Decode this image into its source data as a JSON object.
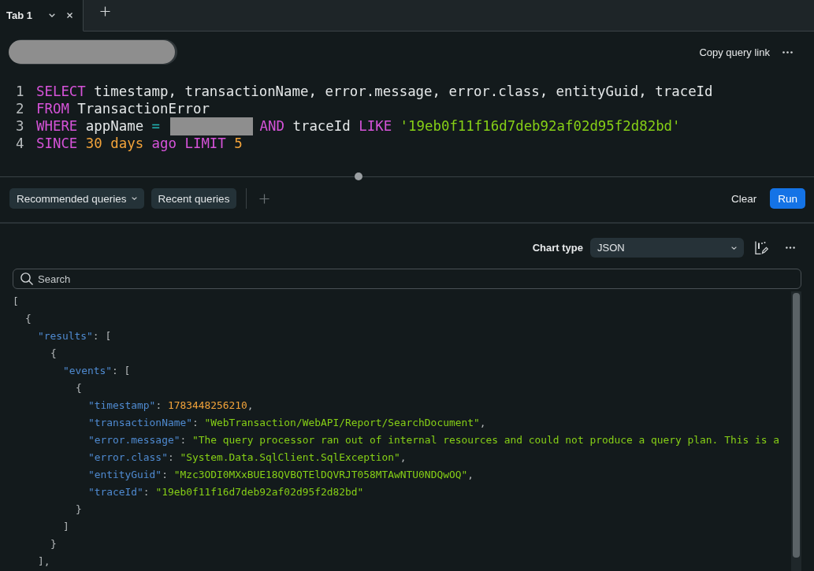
{
  "tabs": [
    {
      "label": "Tab 1",
      "selected": true
    }
  ],
  "query_header": {
    "name": {
      "kind": "redacted"
    },
    "copy_link": "Copy query link"
  },
  "editor": {
    "lines": [
      {
        "number": "1",
        "segments": [
          {
            "kind": "code",
            "tokens": [
              {
                "kind": "keyword",
                "text": "SELECT"
              },
              {
                "kind": "ident",
                "text": " timestamp, transactionName, error.message, error.class, entityGuid, traceId"
              }
            ]
          }
        ]
      },
      {
        "number": "2",
        "segments": [
          {
            "kind": "code",
            "tokens": [
              {
                "kind": "keyword",
                "text": "FROM"
              },
              {
                "kind": "ident",
                "text": " TransactionError"
              }
            ]
          }
        ]
      },
      {
        "number": "3",
        "segments": [
          {
            "kind": "code",
            "tokens": [
              {
                "kind": "keyword",
                "text": "WHERE"
              },
              {
                "kind": "ident",
                "text": " appName "
              },
              {
                "kind": "operator",
                "text": "="
              }
            ]
          },
          {
            "kind": "redacted"
          },
          {
            "kind": "code",
            "tokens": [
              {
                "kind": "keyword",
                "text": "AND"
              },
              {
                "kind": "ident",
                "text": " traceId "
              },
              {
                "kind": "keyword",
                "text": "LIKE"
              },
              {
                "kind": "string",
                "text": " '19eb0f11f16d7deb92af02d95f2d82bd'"
              }
            ]
          }
        ]
      },
      {
        "number": "4",
        "segments": [
          {
            "kind": "code",
            "tokens": [
              {
                "kind": "keyword",
                "text": "SINCE"
              },
              {
                "kind": "literal",
                "text": " 30 days"
              },
              {
                "kind": "keyword",
                "text": " ago LIMIT"
              },
              {
                "kind": "literal",
                "text": " 5"
              }
            ]
          }
        ]
      }
    ]
  },
  "query_toolbar": {
    "buttons": [
      {
        "label": "Recommended queries",
        "kind": "dropdown"
      },
      {
        "label": "Recent queries",
        "kind": "plain"
      }
    ],
    "clear": "Clear",
    "run": "Run"
  },
  "results": {
    "chart_type": {
      "label": "Chart type",
      "value": "JSON"
    },
    "search": {
      "placeholder": "Search"
    },
    "json_lines": [
      {
        "tokens": [
          {
            "kind": "punct",
            "text": "["
          }
        ],
        "children": [
          {
            "tokens": [
              {
                "kind": "punct",
                "text": "{"
              }
            ],
            "children": [
              {
                "tokens": [
                  {
                    "kind": "key",
                    "text": "\"results\""
                  },
                  {
                    "kind": "punct",
                    "text": ": ["
                  }
                ],
                "children": [
                  {
                    "tokens": [
                      {
                        "kind": "punct",
                        "text": "{"
                      }
                    ],
                    "children": [
                      {
                        "tokens": [
                          {
                            "kind": "key",
                            "text": "\"events\""
                          },
                          {
                            "kind": "punct",
                            "text": ": ["
                          }
                        ],
                        "children": [
                          {
                            "tokens": [
                              {
                                "kind": "punct",
                                "text": "{"
                              }
                            ],
                            "children": [
                              {
                                "tokens": [
                                  {
                                    "kind": "key",
                                    "text": "\"timestamp\""
                                  },
                                  {
                                    "kind": "punct",
                                    "text": ": "
                                  },
                                  {
                                    "kind": "number",
                                    "text": "1783448256210"
                                  },
                                  {
                                    "kind": "punct",
                                    "text": ","
                                  }
                                ]
                              },
                              {
                                "tokens": [
                                  {
                                    "kind": "key",
                                    "text": "\"transactionName\""
                                  },
                                  {
                                    "kind": "punct",
                                    "text": ": "
                                  },
                                  {
                                    "kind": "string",
                                    "text": "\"WebTransaction/WebAPI/Report/SearchDocument\""
                                  },
                                  {
                                    "kind": "punct",
                                    "text": ","
                                  }
                                ]
                              },
                              {
                                "tokens": [
                                  {
                                    "kind": "key",
                                    "text": "\"error.message\""
                                  },
                                  {
                                    "kind": "punct",
                                    "text": ": "
                                  },
                                  {
                                    "kind": "string",
                                    "text": "\"The query processor ran out of internal resources and could not produce a query plan. This is a"
                                  }
                                ]
                              },
                              {
                                "tokens": [
                                  {
                                    "kind": "key",
                                    "text": "\"error.class\""
                                  },
                                  {
                                    "kind": "punct",
                                    "text": ": "
                                  },
                                  {
                                    "kind": "string",
                                    "text": "\"System.Data.SqlClient.SqlException\""
                                  },
                                  {
                                    "kind": "punct",
                                    "text": ","
                                  }
                                ]
                              },
                              {
                                "tokens": [
                                  {
                                    "kind": "key",
                                    "text": "\"entityGuid\""
                                  },
                                  {
                                    "kind": "punct",
                                    "text": ": "
                                  },
                                  {
                                    "kind": "string",
                                    "text": "\"Mzc3ODI0MXxBUE18QVBQTElDQVRJT058MTAwNTU0NDQwOQ\""
                                  },
                                  {
                                    "kind": "punct",
                                    "text": ","
                                  }
                                ]
                              },
                              {
                                "tokens": [
                                  {
                                    "kind": "key",
                                    "text": "\"traceId\""
                                  },
                                  {
                                    "kind": "punct",
                                    "text": ": "
                                  },
                                  {
                                    "kind": "string",
                                    "text": "\"19eb0f11f16d7deb92af02d95f2d82bd\""
                                  }
                                ]
                              }
                            ]
                          },
                          {
                            "tokens": [
                              {
                                "kind": "punct",
                                "text": "}"
                              }
                            ]
                          }
                        ]
                      },
                      {
                        "tokens": [
                          {
                            "kind": "punct",
                            "text": "]"
                          }
                        ]
                      }
                    ]
                  },
                  {
                    "tokens": [
                      {
                        "kind": "punct",
                        "text": "}"
                      }
                    ]
                  }
                ]
              },
              {
                "tokens": [
                  {
                    "kind": "punct",
                    "text": "],"
                  }
                ]
              }
            ]
          }
        ]
      }
    ]
  }
}
